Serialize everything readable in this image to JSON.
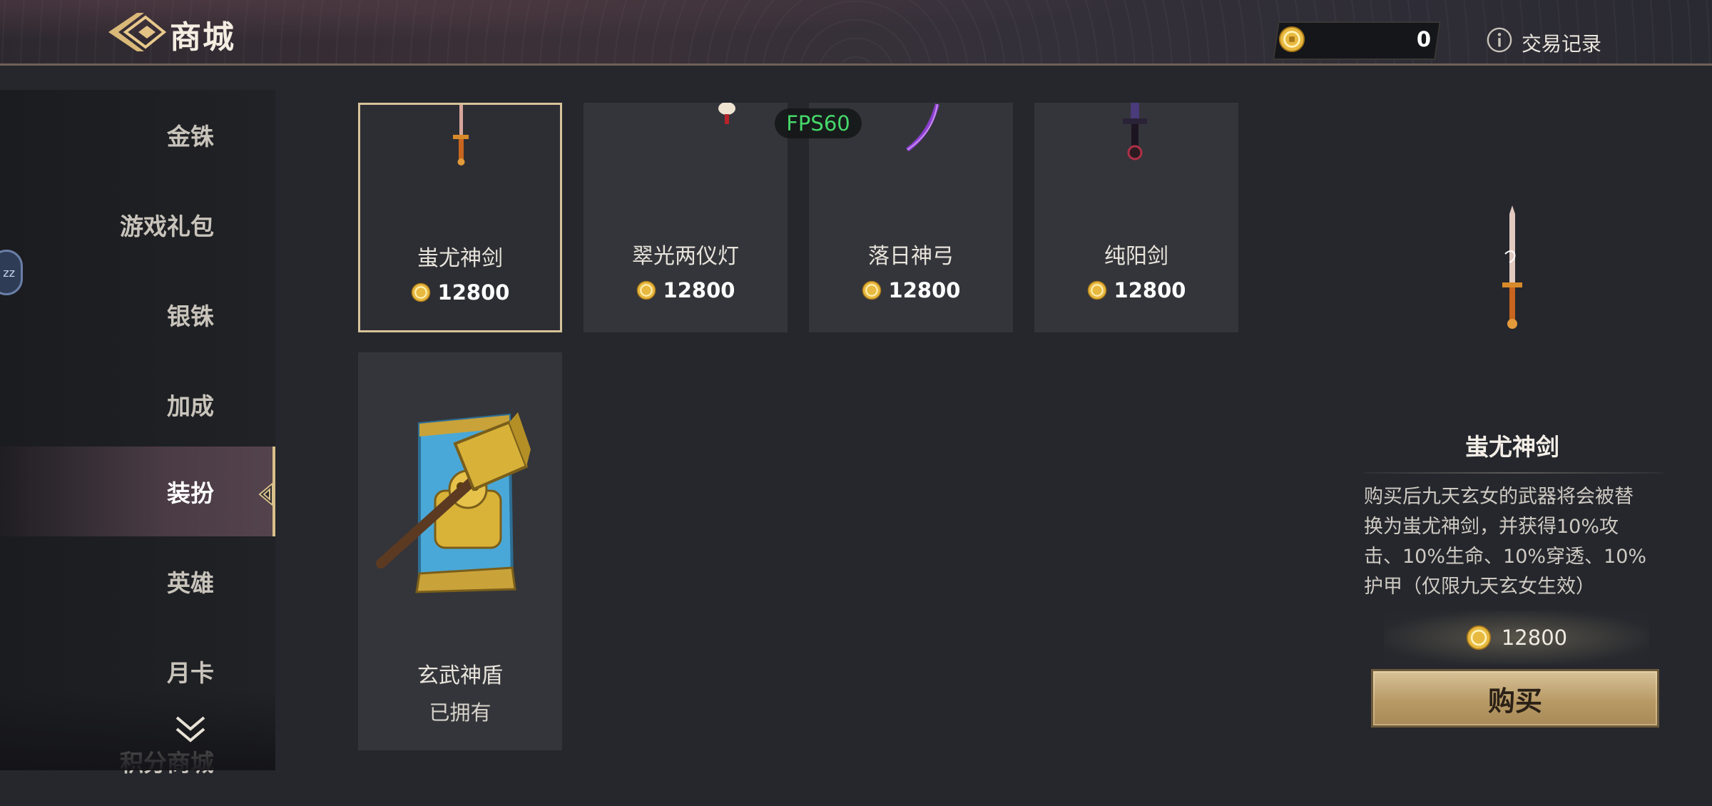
{
  "header": {
    "title": "商城",
    "currency_amount": "0",
    "trade_record_label": "交易记录"
  },
  "sidebar": {
    "items": [
      {
        "label": "金铢",
        "active": false
      },
      {
        "label": "游戏礼包",
        "active": false
      },
      {
        "label": "银铢",
        "active": false
      },
      {
        "label": "加成",
        "active": false
      },
      {
        "label": "装扮",
        "active": true
      },
      {
        "label": "英雄",
        "active": false
      },
      {
        "label": "月卡",
        "active": false
      }
    ],
    "partial_item_label": "积分商城",
    "float_bubble_text": "zz"
  },
  "overlay": {
    "fps": "FPS60"
  },
  "items": [
    {
      "name": "蚩尤神剑",
      "price": "12800",
      "selected": true,
      "icon": "sword-icon"
    },
    {
      "name": "翠光两仪灯",
      "price": "12800",
      "selected": false,
      "icon": "lantern-icon"
    },
    {
      "name": "落日神弓",
      "price": "12800",
      "selected": false,
      "icon": "bow-icon"
    },
    {
      "name": "纯阳剑",
      "price": "12800",
      "selected": false,
      "icon": "dark-sword-icon"
    },
    {
      "name": "玄武神盾",
      "status": "已拥有",
      "selected": false,
      "icon": "hammer-shield-icon"
    }
  ],
  "detail": {
    "name": "蚩尤神剑",
    "description_lines": [
      "购买后九天玄女的武器将会被替",
      "换为蚩尤神剑，并获得10%攻",
      "击、10%生命、10%穿透、10%",
      "护甲（仅限九天玄女生效）"
    ],
    "price": "12800",
    "buy_label": "购买"
  },
  "colors": {
    "accent_gold": "#d6c39a",
    "fps_green": "#46d86a",
    "coin_gold": "#e8b940"
  }
}
